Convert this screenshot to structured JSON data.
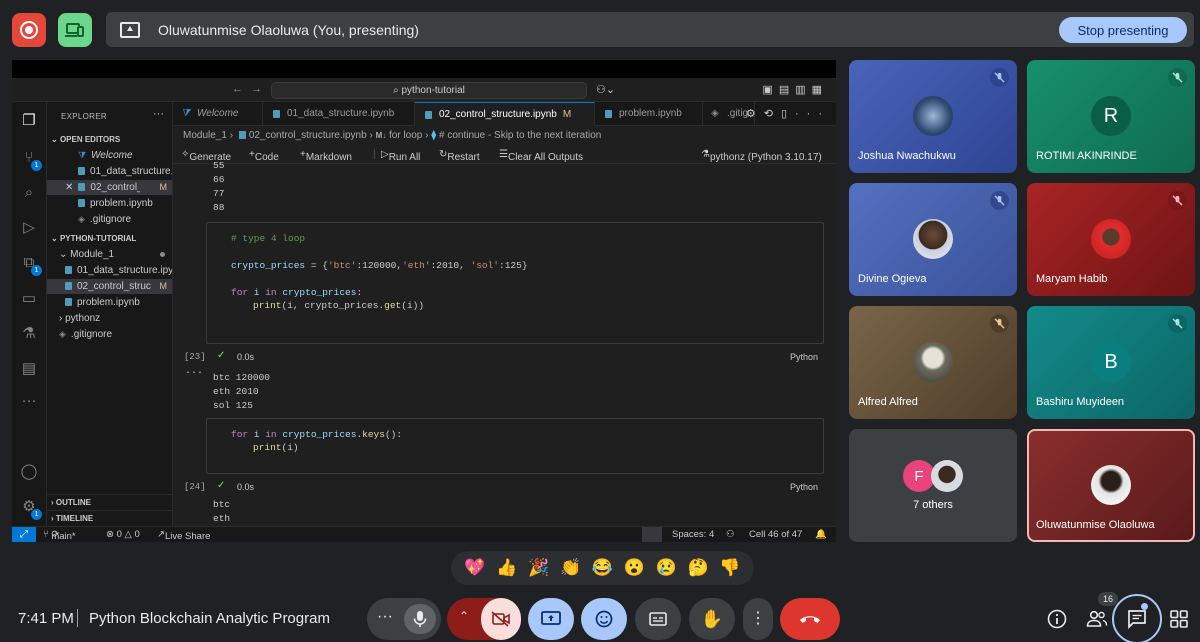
{
  "presenting": {
    "text": "Oluwatunmise Olaoluwa (You, presenting)",
    "stop_label": "Stop presenting"
  },
  "vscode": {
    "search": "python-tutorial",
    "explorer_title": "EXPLORER",
    "open_editors_title": "OPEN EDITORS",
    "open_editors": [
      {
        "label": "Welcome",
        "kind": "vscode"
      },
      {
        "label": "01_data_structure.ipynb",
        "kind": "file"
      },
      {
        "label": "02_control_structure.ipynb",
        "kind": "file",
        "modified": "M"
      },
      {
        "label": "problem.ipynb",
        "kind": "file"
      },
      {
        "label": ".gitignore",
        "kind": "git"
      }
    ],
    "project_title": "PYTHON-TUTORIAL",
    "project_items": [
      {
        "label": "Module_1",
        "kind": "folder"
      },
      {
        "label": "01_data_structure.ipynb",
        "kind": "file"
      },
      {
        "label": "02_control_structure.ipynb",
        "kind": "file",
        "modified": "M"
      },
      {
        "label": "problem.ipynb",
        "kind": "file"
      },
      {
        "label": "pythonz",
        "kind": "folder"
      },
      {
        "label": ".gitignore",
        "kind": "git"
      }
    ],
    "outline_title": "OUTLINE",
    "timeline_title": "TIMELINE",
    "activity_badges": [
      "1",
      "1",
      "1"
    ],
    "tabs": [
      {
        "label": "Welcome"
      },
      {
        "label": "01_data_structure.ipynb"
      },
      {
        "label": "02_control_structure.ipynb",
        "modified": "M"
      },
      {
        "label": "problem.ipynb"
      },
      {
        "label": ".gitig"
      }
    ],
    "breadcrumb": {
      "folder": "Module_1",
      "file": "02_control_structure.ipynb",
      "md_icon": "M↓",
      "section": "for loop",
      "cell": "# continue - Skip to the next iteration"
    },
    "toolbar": {
      "generate": "Generate",
      "code": "Code",
      "markdown": "Markdown",
      "run_all": "Run All",
      "restart": "Restart",
      "clear": "Clear All Outputs",
      "kernel": "pythonz (Python 3.10.17)"
    },
    "prev_output": [
      "55",
      "66",
      "77",
      "88"
    ],
    "cell1": {
      "exec": "[23]",
      "duration": "0.0s",
      "lang": "Python",
      "comment": "# type 4 loop",
      "line2_var": "crypto_prices",
      "line2_eq": " = {",
      "k1": "'btc'",
      "v1": ":120000,",
      "k2": "'eth'",
      "v2": ":2010, ",
      "k3": "'sol'",
      "v3": ":125",
      "line2_end": "}",
      "for_kw": "for",
      "for_var": " i ",
      "in_kw": "in",
      "for_target": " crypto_prices",
      "colon": ":",
      "print_fn": "print",
      "print_args": "(i, crypto_prices.",
      "get_fn": "get",
      "get_args": "(i))"
    },
    "output1": [
      "btc 120000",
      "eth 2010",
      "sol 125"
    ],
    "cell2": {
      "exec": "[24]",
      "duration": "0.0s",
      "lang": "Python",
      "for_kw": "for",
      "for_var": " i ",
      "in_kw": "in",
      "target": " crypto_prices.",
      "keys_fn": "keys",
      "rest": "():",
      "print_fn": "print",
      "print_args": "(i)"
    },
    "output2": [
      "btc",
      "eth"
    ],
    "statusbar": {
      "branch": "main*",
      "problems": "⊗ 0 △ 0",
      "liveshare": "Live Share",
      "spaces": "Spaces: 4",
      "cell": "Cell 46 of 47"
    }
  },
  "participants": [
    {
      "name": "Joshua Nwachukwu",
      "initial": "",
      "bg": "#3d56a8",
      "muted": true
    },
    {
      "name": "ROTIMI AKINRINDE",
      "initial": "R",
      "bg": "#137d5f",
      "muted": true
    },
    {
      "name": "Divine Ogieva",
      "initial": "",
      "bg": "#4a62b0",
      "muted": true
    },
    {
      "name": "Maryam Habib",
      "initial": "",
      "bg": "#9b1c1c",
      "muted": true
    },
    {
      "name": "Alfred Alfred",
      "initial": "",
      "bg": "#6a5840",
      "muted": true
    },
    {
      "name": "Bashiru Muyideen",
      "initial": "B",
      "bg": "#107777",
      "muted": true
    },
    {
      "name": "7 others",
      "initial": "F",
      "bg": "#3c4043",
      "muted": false
    },
    {
      "name": "Oluwatunmise Olaoluwa",
      "initial": "",
      "bg": "#7a2a2a",
      "muted": false
    }
  ],
  "reactions": [
    "💖",
    "👍",
    "🎉",
    "👏",
    "😂",
    "😮",
    "😢",
    "🤔",
    "👎"
  ],
  "bottom": {
    "time": "7:41 PM",
    "meeting_title": "Python Blockchain Analytic Program",
    "people_count": "16"
  },
  "colors": {
    "hangup": "#dc362e",
    "accent": "#a8c7fa",
    "cam_off": "#f9dedc"
  }
}
